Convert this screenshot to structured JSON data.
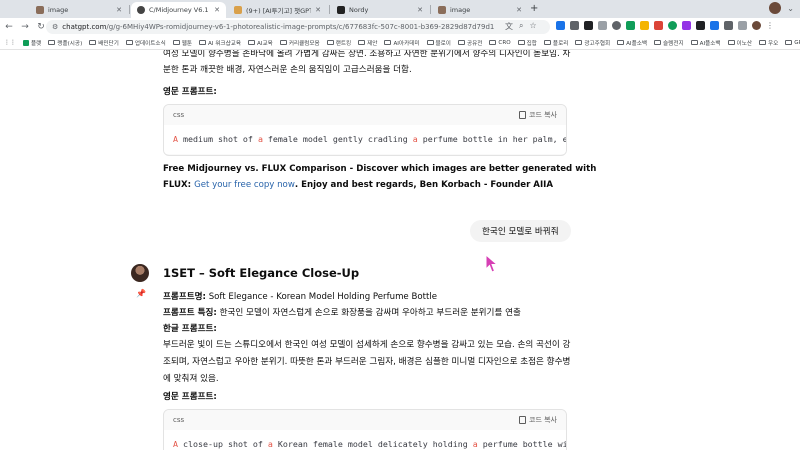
{
  "browser": {
    "tabs": [
      {
        "title": "image",
        "favicon_color": "#8a6d5a"
      },
      {
        "title": "C/Midjourney V6.1 - Photore...",
        "favicon_color": "#444444"
      },
      {
        "title": "(9+) [AI투기고] 챗GPT AI홀 스케...",
        "favicon_color": "#d9a04a"
      },
      {
        "title": "Nordy",
        "favicon_color": "#222222"
      },
      {
        "title": "image",
        "favicon_color": "#8a6d5a"
      }
    ],
    "new_tab_label": "+",
    "url_host": "chatgpt.com",
    "url_path": "/g/g-6MHiy4WPs-romidjourney-v6-1-photorealistic-image-prompts/c/677683fc-507c-8001-b369-2829d87d79d1",
    "bookmarks": [
      "플랫",
      "랭플(시공)",
      "배민단기",
      "업데이트소식",
      "웹툰",
      "AI 워크샵교육",
      "AI교육",
      "커리큘럼모음",
      "랜트킹",
      "제안",
      "AI아카데미",
      "블로이",
      "공유전",
      "CRO",
      "집합",
      "플로리",
      "광고주협회",
      "AI플소백",
      "슬렘전지",
      "AI플소백",
      "이노산",
      "우오",
      "GPTs"
    ],
    "extension_colors": [
      "#1a73e8",
      "#0f9d58",
      "#f4b400",
      "#db4437",
      "#5f6368",
      "#202124",
      "#9334e6"
    ]
  },
  "chat": {
    "top_line_1": "여성 모델이 향수병을 손바닥에 올려 가볍게 감싸는 장면. 조용하고 자연한 분위기에서 향수의 디자인이 돋보임. 차",
    "top_line_2": "분한 톤과 깨끗한 배경, 자연스러운 손의 움직임이 고급스러움을 더함.",
    "en_prompt_label_1": "영문 프롬프트:",
    "code1": {
      "lang": "css",
      "copy_label": "코드 복사",
      "tokens": [
        "A",
        " medium shot of ",
        "a",
        " female model gently cradling ",
        "a",
        " perfume bottle in her palm, evok"
      ]
    },
    "promo": {
      "text_1": "Free Midjourney vs. FLUX Comparison - Discover which images are better generated with",
      "text_2a": "FLUX: ",
      "link": "Get your free copy now",
      "text_2b": ". Enjoy and best regards, Ben Korbach - Founder AIIA"
    },
    "user_message": "한국인 모델로 바꿔줘",
    "response": {
      "title": "1SET – Soft Elegance Close-Up",
      "name_label": "프롬프트명:",
      "name_value": " Soft Elegance - Korean Model Holding Perfume Bottle",
      "feature_label": "프롬프트 특징:",
      "feature_value": " 한국인 모델이 자연스럽게 손으로 화장품을 감싸며 우아하고 부드러운 분위기를 연출",
      "kr_label": "한글 프롬프트:",
      "kr_line_1": "부드러운 빛이 드는 스튜디오에서 한국인 여성 모델이 섬세하게 손으로 향수병을 감싸고 있는 모습. 손의 곡선이 강",
      "kr_line_2": "조되며, 자연스럽고 우아한 분위기. 따뜻한 톤과 부드러운 그림자, 배경은 심플한 미니멀 디자인으로 초점은 향수병",
      "kr_line_3": "에 맞춰져 있음.",
      "en_label": "영문 프롬프트:",
      "code2": {
        "lang": "css",
        "copy_label": "코드 복사",
        "tokens": [
          "A",
          " close-up shot of ",
          "a",
          " Korean female model delicately holding ",
          "a",
          " perfume bottle with h"
        ]
      }
    }
  }
}
